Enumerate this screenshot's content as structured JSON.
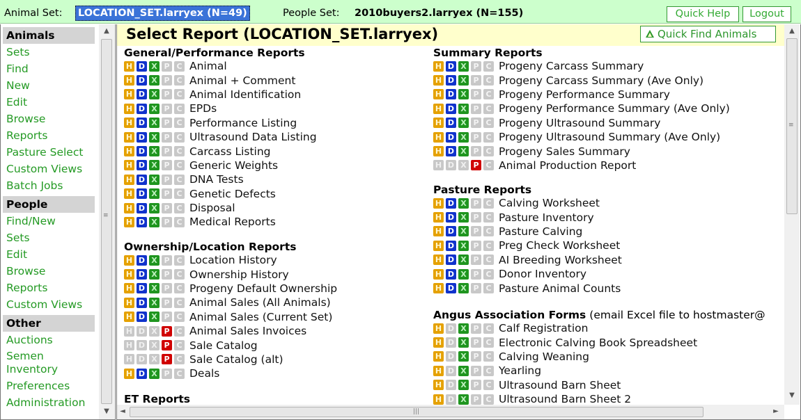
{
  "topbar": {
    "animal_set_label": "Animal Set:",
    "animal_set_name": "LOCATION_SET.larryex (N=49)",
    "people_set_label": "People Set:",
    "people_set_name": "2010buyers2.larryex (N=155)",
    "quick_help": "Quick Help",
    "logout": "Logout"
  },
  "sidebar": {
    "sections": [
      {
        "title": "Animals",
        "items": [
          "Sets",
          "Find",
          "New",
          "Edit",
          "Browse",
          "Reports",
          "Pasture Select",
          "Custom Views",
          "Batch Jobs"
        ]
      },
      {
        "title": "People",
        "items": [
          "Find/New",
          "Sets",
          "Edit",
          "Browse",
          "Reports",
          "Custom Views"
        ]
      },
      {
        "title": "Other",
        "items": [
          "Auctions",
          "Semen Inventory",
          "Preferences",
          "Administration"
        ]
      }
    ]
  },
  "main": {
    "title": "Select Report (LOCATION_SET.larryex)",
    "quick_find": "Quick Find Animals",
    "badge_letters": {
      "H": "H",
      "D": "D",
      "X": "X",
      "P": "P",
      "C": "C"
    },
    "left_sections": [
      {
        "title": "General/Performance Reports",
        "rows": [
          {
            "label": "Animal",
            "on": "HDX"
          },
          {
            "label": "Animal + Comment",
            "on": "HDX"
          },
          {
            "label": "Animal Identification",
            "on": "HDX"
          },
          {
            "label": "EPDs",
            "on": "HDX"
          },
          {
            "label": "Performance Listing",
            "on": "HDX"
          },
          {
            "label": "Ultrasound Data Listing",
            "on": "HDX"
          },
          {
            "label": "Carcass Listing",
            "on": "HDX"
          },
          {
            "label": "Generic Weights",
            "on": "HDX"
          },
          {
            "label": "DNA Tests",
            "on": "HDX"
          },
          {
            "label": "Genetic Defects",
            "on": "HDX"
          },
          {
            "label": "Disposal",
            "on": "HDX"
          },
          {
            "label": "Medical Reports",
            "on": "HDX"
          }
        ]
      },
      {
        "title": "Ownership/Location Reports",
        "rows": [
          {
            "label": "Location History",
            "on": "HDX"
          },
          {
            "label": "Ownership History",
            "on": "HDX"
          },
          {
            "label": "Progeny Default Ownership",
            "on": "HDX"
          },
          {
            "label": "Animal Sales (All Animals)",
            "on": "HDX"
          },
          {
            "label": "Animal Sales (Current Set)",
            "on": "HDX"
          },
          {
            "label": "Animal Sales Invoices",
            "on": "P"
          },
          {
            "label": "Sale Catalog",
            "on": "P"
          },
          {
            "label": "Sale Catalog (alt)",
            "on": "P"
          },
          {
            "label": "Deals",
            "on": "HDX"
          }
        ]
      },
      {
        "title": "ET Reports",
        "rows": []
      }
    ],
    "right_sections": [
      {
        "title": "Summary Reports",
        "rows": [
          {
            "label": "Progeny Carcass Summary",
            "on": "HDX"
          },
          {
            "label": "Progeny Carcass Summary (Ave Only)",
            "on": "HDX"
          },
          {
            "label": "Progeny Performance Summary",
            "on": "HDX"
          },
          {
            "label": "Progeny Performance Summary (Ave Only)",
            "on": "HDX"
          },
          {
            "label": "Progeny Ultrasound Summary",
            "on": "HDX"
          },
          {
            "label": "Progeny Ultrasound Summary (Ave Only)",
            "on": "HDX"
          },
          {
            "label": "Progeny Sales Summary",
            "on": "HDX"
          },
          {
            "label": "Animal Production Report",
            "on": "P"
          }
        ]
      },
      {
        "title": "Pasture Reports",
        "rows": [
          {
            "label": "Calving Worksheet",
            "on": "HDX"
          },
          {
            "label": "Pasture Inventory",
            "on": "HDX"
          },
          {
            "label": "Pasture Calving",
            "on": "HDX"
          },
          {
            "label": "Preg Check Worksheet",
            "on": "HDX"
          },
          {
            "label": "AI Breeding Worksheet",
            "on": "HDX"
          },
          {
            "label": "Donor Inventory",
            "on": "HDX"
          },
          {
            "label": "Pasture Animal Counts",
            "on": "HDX"
          }
        ]
      },
      {
        "title": "Angus Association Forms",
        "note": "(email Excel file to hostmaster@",
        "rows": [
          {
            "label": "Calf Registration",
            "on": "HX"
          },
          {
            "label": "Electronic Calving Book Spreadsheet",
            "on": "HX"
          },
          {
            "label": "Calving Weaning",
            "on": "HX"
          },
          {
            "label": "Yearling",
            "on": "HX"
          },
          {
            "label": "Ultrasound Barn Sheet",
            "on": "HX"
          },
          {
            "label": "Ultrasound Barn Sheet 2",
            "on": "HX"
          }
        ]
      }
    ]
  }
}
